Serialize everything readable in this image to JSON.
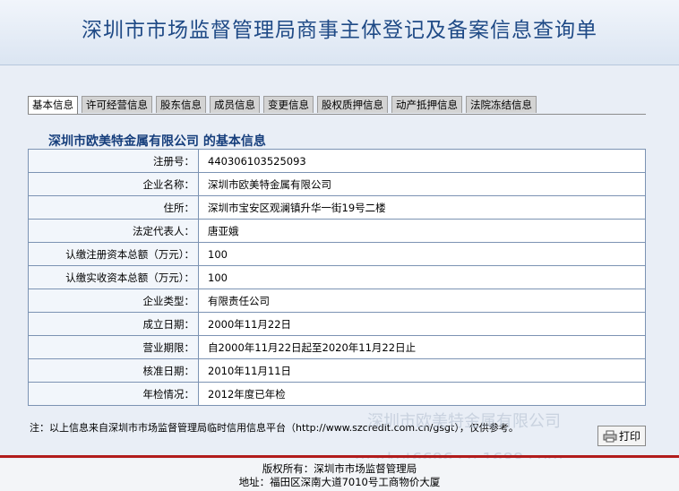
{
  "header": {
    "title": "深圳市市场监督管理局商事主体登记及备案信息查询单"
  },
  "tabs": [
    {
      "label": "基本信息"
    },
    {
      "label": "许可经营信息"
    },
    {
      "label": "股东信息"
    },
    {
      "label": "成员信息"
    },
    {
      "label": "变更信息"
    },
    {
      "label": "股权质押信息"
    },
    {
      "label": "动产抵押信息"
    },
    {
      "label": "法院冻结信息"
    }
  ],
  "company_title": "深圳市欧美特金属有限公司 的基本信息",
  "rows": [
    {
      "label": "注册号：",
      "value": "440306103525093"
    },
    {
      "label": "企业名称：",
      "value": "深圳市欧美特金属有限公司"
    },
    {
      "label": "住所：",
      "value": "深圳市宝安区观澜镇升华一街19号二楼"
    },
    {
      "label": "法定代表人：",
      "value": "唐亚娥"
    },
    {
      "label": "认缴注册资本总额（万元）：",
      "value": "100"
    },
    {
      "label": "认缴实收资本总额（万元）：",
      "value": "100"
    },
    {
      "label": "企业类型：",
      "value": "有限责任公司"
    },
    {
      "label": "成立日期：",
      "value": "2000年11月22日"
    },
    {
      "label": "营业期限：",
      "value": "自2000年11月22日起至2020年11月22日止"
    },
    {
      "label": "核准日期：",
      "value": "2010年11月11日"
    },
    {
      "label": "年检情况：",
      "value": "2012年度已年检"
    }
  ],
  "note": "注：以上信息来自深圳市市场监督管理局临时信用信息平台（http://www.szcredit.com.cn/gsgt），仅供参考。",
  "print_button": {
    "label": "打印",
    "icon": "printer-icon"
  },
  "footer": {
    "line1": "版权所有：深圳市市场监督管理局",
    "line2": "地址：福田区深南大道7010号工商物价大厦"
  },
  "watermark": {
    "text1": "深圳市欧美特金属有限公司",
    "text2": "market6696.cn.1688.com"
  },
  "colors": {
    "title": "#1f4a86",
    "accent_line": "#b21c1c",
    "border": "#7c93b3"
  }
}
